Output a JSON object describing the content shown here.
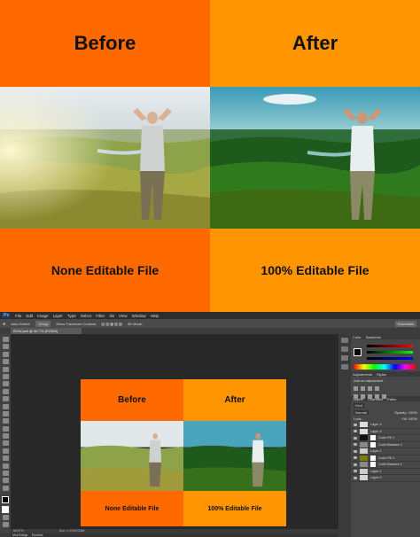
{
  "top": {
    "before_label": "Before",
    "after_label": "After",
    "none_editable": "None Editable File",
    "editable": "100% Editable File"
  },
  "ps": {
    "menu": [
      "Ps",
      "File",
      "Edit",
      "Image",
      "Layer",
      "Type",
      "Select",
      "Filter",
      "3D",
      "View",
      "Window",
      "Help"
    ],
    "options": {
      "auto_select": "Auto-Select:",
      "group": "Group",
      "transform": "Show Transform Controls",
      "mode": "3D Mode:",
      "workspace": "Essentials"
    },
    "doc_tab": "BOW.psd @ 66.7% (RGB/8)",
    "doc": {
      "before": "Before",
      "after": "After",
      "none_editable": "None Editable File",
      "editable": "100% Editable File"
    },
    "status": {
      "zoom": "66.67%",
      "doc_size": "Doc: 1.17M/23.6M"
    },
    "bottom_tabs": [
      "Mini Bridge",
      "Timeline"
    ],
    "panels": {
      "color_tabs": [
        "Color",
        "Swatches"
      ],
      "adjust_tabs": [
        "Adjustments",
        "Styles"
      ],
      "add_adjustment": "Add an adjustment",
      "layer_tabs": [
        "Layers",
        "Channels",
        "Paths"
      ],
      "kind": "Kind",
      "normal": "Normal",
      "opacity": "Opacity: 100%",
      "lock": "Lock:",
      "fill": "Fill: 100%",
      "layers": [
        {
          "name": "Layer 4",
          "thumb": "#dddddd",
          "mask": false
        },
        {
          "name": "Layer 4",
          "thumb": "#dddddd",
          "mask": false
        },
        {
          "name": "Color Fill 1",
          "thumb": "#111111",
          "mask": true
        },
        {
          "name": "Color Balance 2",
          "thumb": "#888888",
          "mask": true
        },
        {
          "name": "Layer 1",
          "thumb": "#cccccc",
          "mask": false
        },
        {
          "name": "Color Fill 1",
          "thumb": "#7a7a10",
          "mask": true
        },
        {
          "name": "Color Balance 1",
          "thumb": "#888888",
          "mask": true
        },
        {
          "name": "Layer 1",
          "thumb": "#cccccc",
          "mask": false
        },
        {
          "name": "Layer 0",
          "thumb": "#d4d4d4",
          "mask": false
        }
      ]
    }
  },
  "colors": {
    "orange_dark": "#ff6a00",
    "orange_light": "#ff9500"
  }
}
